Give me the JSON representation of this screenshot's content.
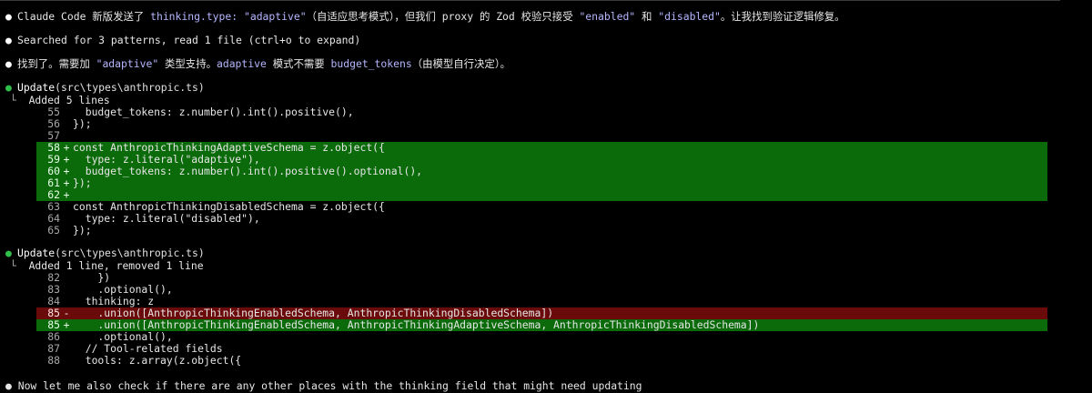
{
  "messages": {
    "m1": {
      "bullet": "●",
      "t1": "Claude Code 新版发送了 ",
      "c1": "thinking.type: \"adaptive\"",
      "t2": "（自适应思考模式），但我们 proxy 的 Zod 校验只接受 ",
      "c2": "\"enabled\"",
      "t3": " 和 ",
      "c3": "\"disabled\"",
      "t4": "。让我找到验证逻辑修复。"
    },
    "m2": {
      "bullet": "●",
      "text": "Searched for 3 patterns, read 1 file (ctrl+o to expand)"
    },
    "m3": {
      "bullet": "●",
      "t1": "找到了。需要加 ",
      "c1": "\"adaptive\"",
      "t2": " 类型支持。",
      "c2": "adaptive",
      "t3": " 模式不需要 ",
      "c3": "budget_tokens",
      "t4": "（由模型自行决定）。"
    }
  },
  "updates": [
    {
      "bullet": "●",
      "tool": "Update",
      "args": "(src\\types\\anthropic.ts)",
      "tree": "└",
      "summary": "Added 5 lines",
      "lines": [
        {
          "n": "55",
          "s": "",
          "code": "  budget_tokens: z.number().int().positive(),",
          "kind": "ctx"
        },
        {
          "n": "56",
          "s": "",
          "code": "});",
          "kind": "ctx"
        },
        {
          "n": "57",
          "s": "",
          "code": "",
          "kind": "ctx"
        },
        {
          "n": "58",
          "s": "+",
          "code": "const AnthropicThinkingAdaptiveSchema = z.object({",
          "kind": "add"
        },
        {
          "n": "59",
          "s": "+",
          "code": "  type: z.literal(\"adaptive\"),",
          "kind": "add"
        },
        {
          "n": "60",
          "s": "+",
          "code": "  budget_tokens: z.number().int().positive().optional(),",
          "kind": "add"
        },
        {
          "n": "61",
          "s": "+",
          "code": "});",
          "kind": "add"
        },
        {
          "n": "62",
          "s": "+",
          "code": "",
          "kind": "add"
        },
        {
          "n": "63",
          "s": "",
          "code": "const AnthropicThinkingDisabledSchema = z.object({",
          "kind": "ctx"
        },
        {
          "n": "64",
          "s": "",
          "code": "  type: z.literal(\"disabled\"),",
          "kind": "ctx"
        },
        {
          "n": "65",
          "s": "",
          "code": "});",
          "kind": "ctx"
        }
      ]
    },
    {
      "bullet": "●",
      "tool": "Update",
      "args": "(src\\types\\anthropic.ts)",
      "tree": "└",
      "summary": "Added 1 line, removed 1 line",
      "lines": [
        {
          "n": "82",
          "s": "",
          "code": "    })",
          "kind": "ctx"
        },
        {
          "n": "83",
          "s": "",
          "code": "    .optional(),",
          "kind": "ctx"
        },
        {
          "n": "84",
          "s": "",
          "code": "  thinking: z",
          "kind": "ctx"
        },
        {
          "n": "85",
          "s": "-",
          "code": "    .union([AnthropicThinkingEnabledSchema, AnthropicThinkingDisabledSchema])",
          "kind": "del"
        },
        {
          "n": "85",
          "s": "+",
          "code": "    .union([AnthropicThinkingEnabledSchema, AnthropicThinkingAdaptiveSchema, AnthropicThinkingDisabledSchema])",
          "kind": "add"
        },
        {
          "n": "86",
          "s": "",
          "code": "    .optional(),",
          "kind": "ctx"
        },
        {
          "n": "87",
          "s": "",
          "code": "  // Tool-related fields",
          "kind": "ctx"
        },
        {
          "n": "88",
          "s": "",
          "code": "  tools: z.array(z.object({",
          "kind": "ctx"
        }
      ]
    }
  ],
  "cutoff_text": "● Now let me also check if there are any other places with the thinking field that might need updating",
  "colors": {
    "background": "#000000",
    "added_bg": "#0b6b0b",
    "removed_bg": "#6b0a0a",
    "inline_code": "#b5b6ff",
    "bullet_green": "#2fbf4a"
  }
}
